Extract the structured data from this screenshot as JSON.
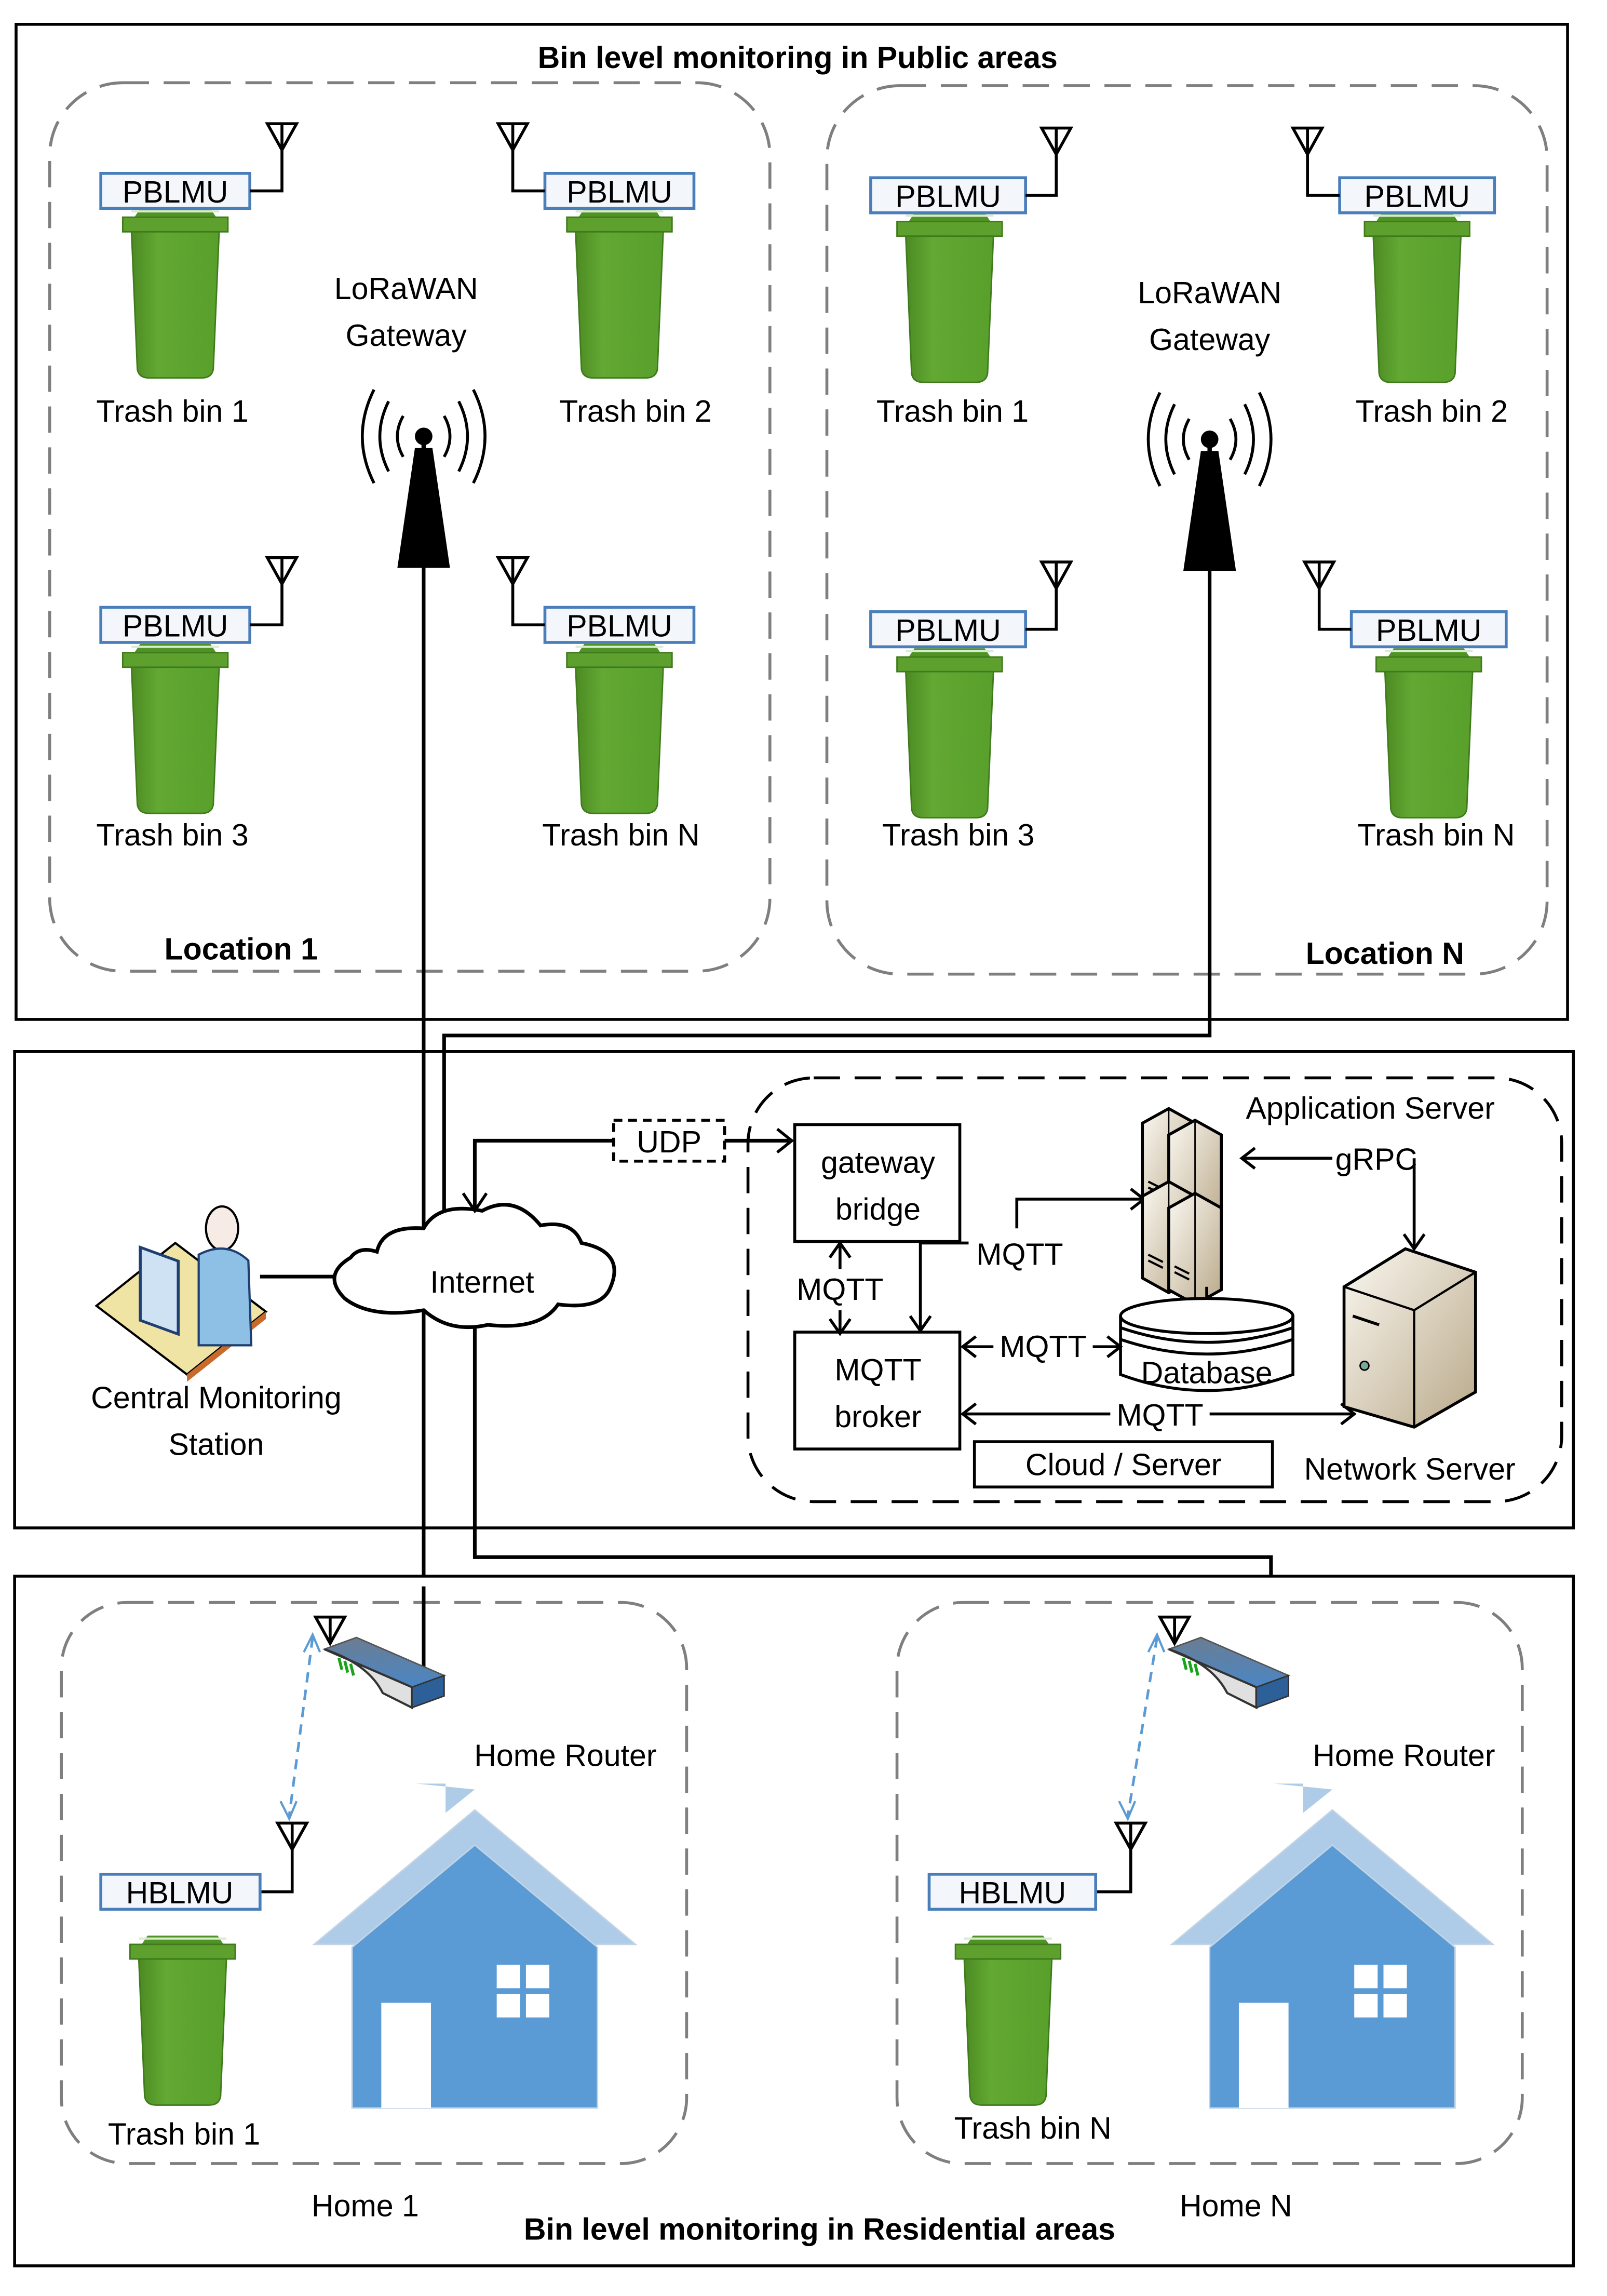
{
  "colors": {
    "bin_green": "#5da02e",
    "bin_dark": "#3f7a1c",
    "house_blue": "#5b9bd5",
    "roof_blue": "#aecbe8",
    "unit_border": "#4a7ebb",
    "wifi_link": "#5b9bd5",
    "server_tan": "#d8ccb4"
  },
  "public_section": {
    "title": "Bin level monitoring in Public areas",
    "locations": [
      {
        "label": "Location 1",
        "gateway_label_line1": "LoRaWAN",
        "gateway_label_line2": "Gateway",
        "bins": [
          {
            "unit": "PBLMU",
            "label": "Trash bin 1"
          },
          {
            "unit": "PBLMU",
            "label": "Trash bin 2"
          },
          {
            "unit": "PBLMU",
            "label": "Trash bin 3"
          },
          {
            "unit": "PBLMU",
            "label": "Trash bin N"
          }
        ]
      },
      {
        "label": "Location N",
        "gateway_label_line1": "LoRaWAN",
        "gateway_label_line2": "Gateway",
        "bins": [
          {
            "unit": "PBLMU",
            "label": "Trash bin 1"
          },
          {
            "unit": "PBLMU",
            "label": "Trash bin 2"
          },
          {
            "unit": "PBLMU",
            "label": "Trash bin 3"
          },
          {
            "unit": "PBLMU",
            "label": "Trash bin N"
          }
        ]
      }
    ]
  },
  "middle_section": {
    "station_line1": "Central Monitoring",
    "station_line2": "Station",
    "internet": "Internet",
    "udp": "UDP",
    "gateway_bridge_line1": "gateway",
    "gateway_bridge_line2": "bridge",
    "mqtt_broker_line1": "MQTT",
    "mqtt_broker_line2": "broker",
    "application_server": "Application Server",
    "grpc": "gRPC",
    "database": "Database",
    "network_server": "Network Server",
    "cloud_server": "Cloud / Server",
    "mqtt_labels": [
      "MQTT",
      "MQTT",
      "MQTT",
      "MQTT"
    ]
  },
  "residential_section": {
    "title": "Bin level monitoring in Residential areas",
    "homes": [
      {
        "label": "Home 1",
        "router": "Home Router",
        "unit": "HBLMU",
        "bin": "Trash bin 1"
      },
      {
        "label": "Home N",
        "router": "Home Router",
        "unit": "HBLMU",
        "bin": "Trash bin N"
      }
    ]
  }
}
